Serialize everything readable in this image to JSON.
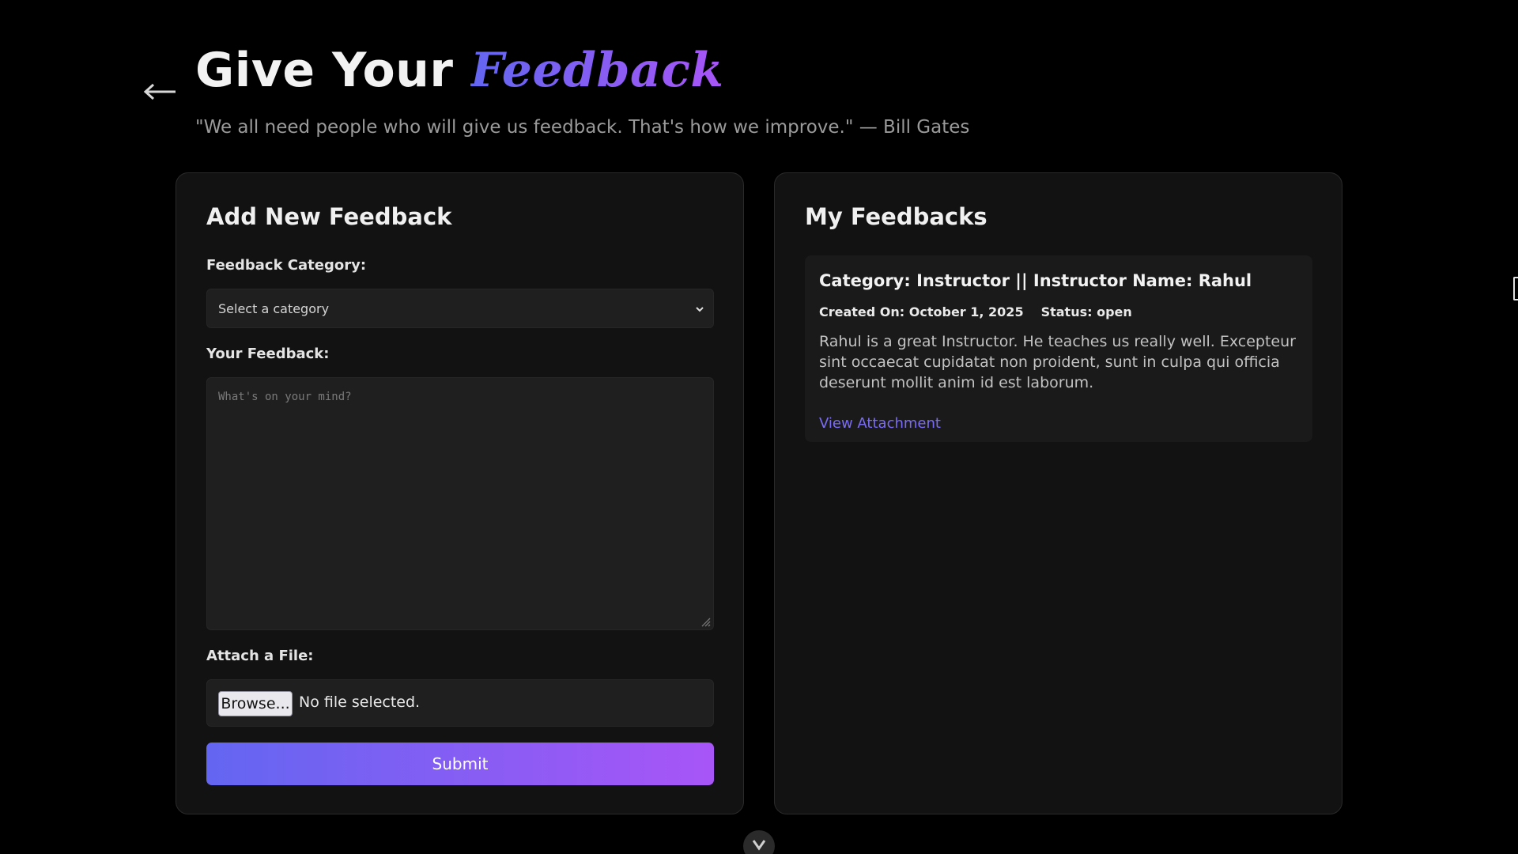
{
  "header": {
    "title_plain": "Give Your ",
    "title_accent": "Feedback",
    "quote": "\"We all need people who will give us feedback. That's how we improve.\" — Bill Gates"
  },
  "form": {
    "title": "Add New Feedback",
    "category_label": "Feedback Category:",
    "category_value": "Select a category",
    "feedback_label": "Your Feedback:",
    "feedback_placeholder": "What's on your mind?",
    "file_label": "Attach a File:",
    "browse_label": "Browse...",
    "file_status": "No file selected.",
    "submit_label": "Submit"
  },
  "my_feedbacks": {
    "title": "My Feedbacks",
    "items": [
      {
        "heading": "Category: Instructor || Instructor Name: Rahul",
        "created": "Created On: October 1, 2025",
        "status": "Status: open",
        "body": "Rahul is a great Instructor. He teaches us really well. Excepteur sint occaecat cupidatat non proident, sunt in culpa qui officia deserunt mollit anim id est laborum.",
        "link": "View Attachment"
      }
    ]
  },
  "icons": {
    "back": "left-arrow-icon",
    "select": "chevron-down-icon",
    "scroll": "chevron-down-icon"
  },
  "colors": {
    "accent_start": "#6366f1",
    "accent_end": "#a855f7",
    "link": "#7b6cf6",
    "background": "#000000",
    "card": "#121212"
  }
}
